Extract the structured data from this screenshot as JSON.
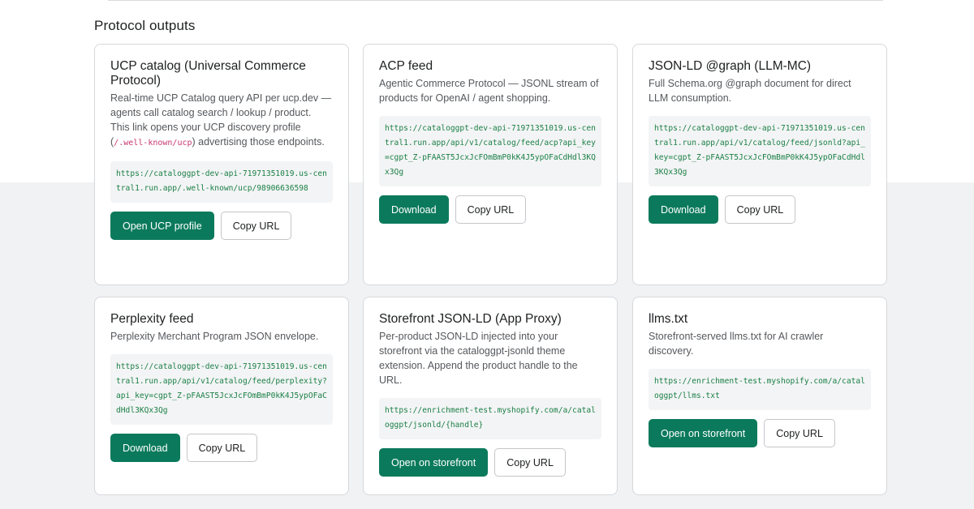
{
  "section": {
    "title": "Protocol outputs"
  },
  "cards": [
    {
      "title": "UCP catalog (Universal Commerce Protocol)",
      "desc_before": "Real-time UCP Catalog query API per ucp.dev — agents call catalog search / lookup / product. This link opens your UCP discovery profile (",
      "desc_code": "/.well-known/ucp",
      "desc_after": ") advertising those endpoints.",
      "url": "https://cataloggpt-dev-api-71971351019.us-central1.run.app/.well-known/ucp/98906636598",
      "primary_label": "Open UCP profile",
      "secondary_label": "Copy URL"
    },
    {
      "title": "ACP feed",
      "desc": "Agentic Commerce Protocol — JSONL stream of products for OpenAI / agent shopping.",
      "url": "https://cataloggpt-dev-api-71971351019.us-central1.run.app/api/v1/catalog/feed/acp?api_key=cgpt_Z-pFAAST5JcxJcFOmBmP0kK4J5ypOFaCdHdl3KQx3Qg",
      "primary_label": "Download",
      "secondary_label": "Copy URL"
    },
    {
      "title": "JSON-LD @graph (LLM-MC)",
      "desc": "Full Schema.org @graph document for direct LLM consumption.",
      "url": "https://cataloggpt-dev-api-71971351019.us-central1.run.app/api/v1/catalog/feed/jsonld?api_key=cgpt_Z-pFAAST5JcxJcFOmBmP0kK4J5ypOFaCdHdl3KQx3Qg",
      "primary_label": "Download",
      "secondary_label": "Copy URL"
    },
    {
      "title": "Perplexity feed",
      "desc": "Perplexity Merchant Program JSON envelope.",
      "url": "https://cataloggpt-dev-api-71971351019.us-central1.run.app/api/v1/catalog/feed/perplexity?api_key=cgpt_Z-pFAAST5JcxJcFOmBmP0kK4J5ypOFaCdHdl3KQx3Qg",
      "primary_label": "Download",
      "secondary_label": "Copy URL"
    },
    {
      "title": "Storefront JSON-LD (App Proxy)",
      "desc": "Per-product JSON-LD injected into your storefront via the cataloggpt-jsonld theme extension. Append the product handle to the URL.",
      "url": "https://enrichment-test.myshopify.com/a/cataloggpt/jsonld/{handle}",
      "primary_label": "Open on storefront",
      "secondary_label": "Copy URL"
    },
    {
      "title": "llms.txt",
      "desc": "Storefront-served llms.txt for AI crawler discovery.",
      "url": "https://enrichment-test.myshopify.com/a/cataloggpt/llms.txt",
      "primary_label": "Open on storefront",
      "secondary_label": "Copy URL"
    }
  ]
}
